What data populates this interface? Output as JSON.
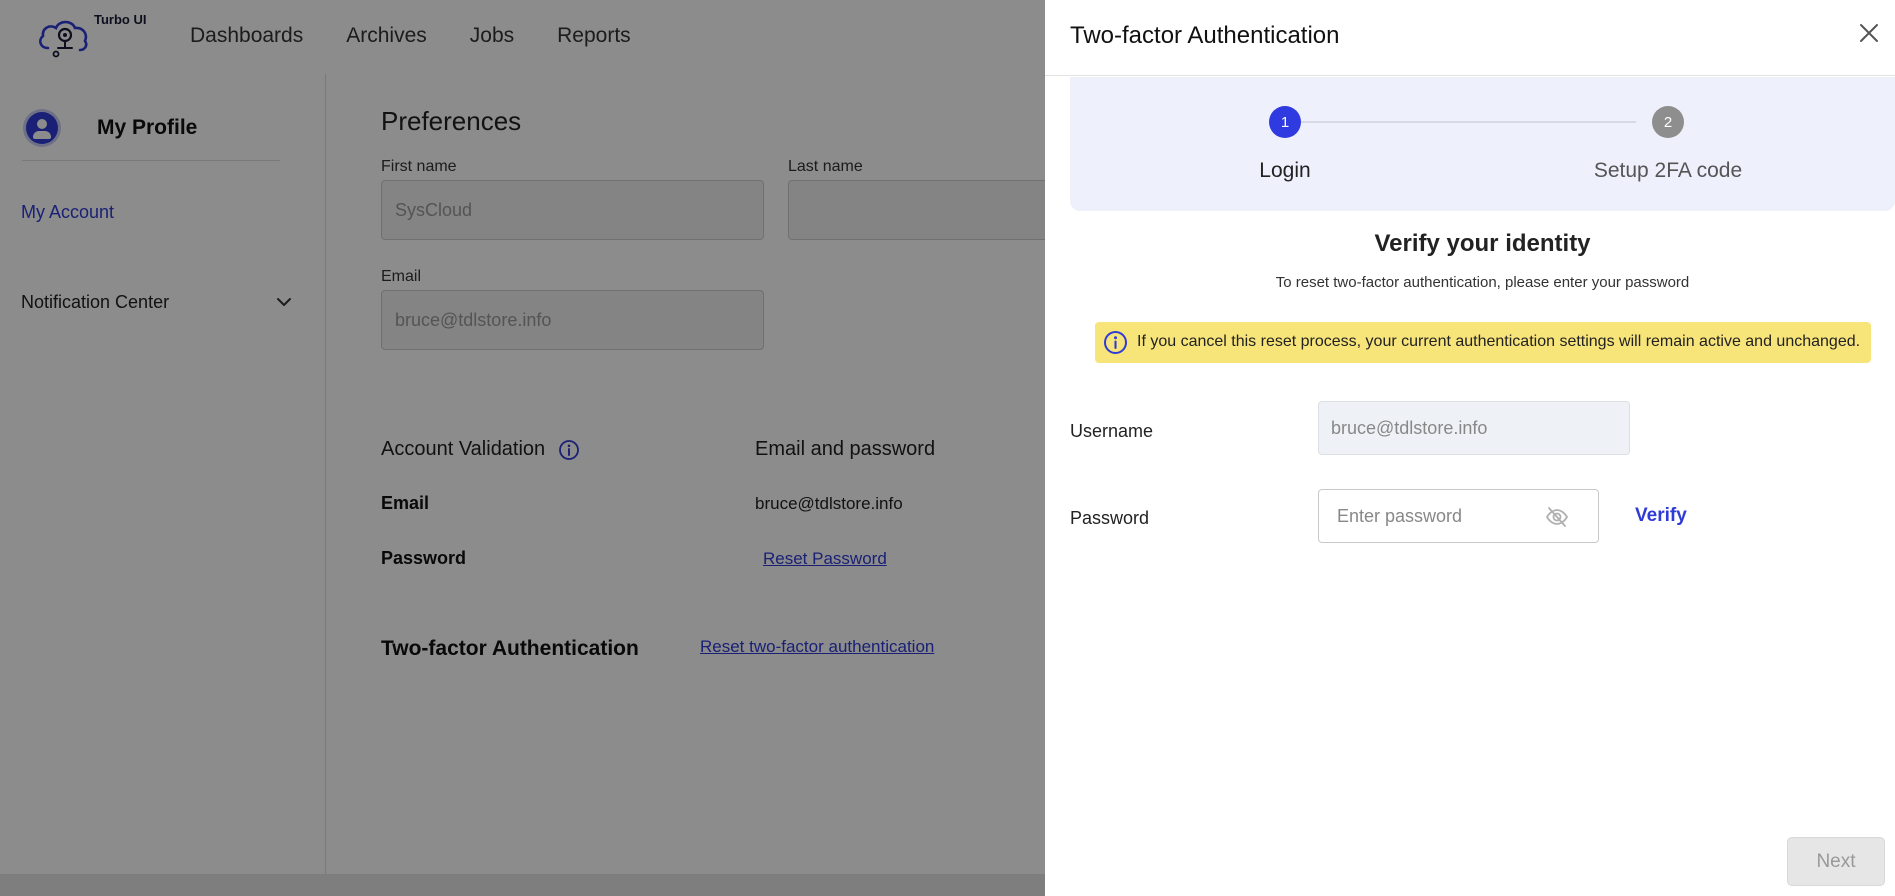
{
  "app": {
    "logo_text": "Turbo UI",
    "nav": [
      "Dashboards",
      "Archives",
      "Jobs",
      "Reports"
    ]
  },
  "sidebar": {
    "profile_title": "My Profile",
    "my_account": "My Account",
    "notification_center": "Notification Center"
  },
  "preferences": {
    "title": "Preferences",
    "first_name_label": "First name",
    "first_name_value": "SysCloud",
    "last_name_label": "Last name",
    "last_name_value": "",
    "email_label": "Email",
    "email_value": "bruce@tdlstore.info"
  },
  "account_validation": {
    "title": "Account Validation",
    "method_header": "Email and password",
    "email_label": "Email",
    "email_value": "bruce@tdlstore.info",
    "password_label": "Password",
    "reset_password_link": "Reset Password",
    "tfa_label": "Two-factor Authentication",
    "reset_tfa_link": "Reset two-factor authentication"
  },
  "drawer": {
    "title": "Two-factor Authentication",
    "steps": [
      {
        "number": "1",
        "label": "Login",
        "active": true
      },
      {
        "number": "2",
        "label": "Setup 2FA code",
        "active": false
      }
    ],
    "verify_title": "Verify your identity",
    "verify_subtitle": "To reset two-factor authentication, please enter your password",
    "alert_text": "If you cancel this reset process, your current authentication settings will remain active and unchanged.",
    "username_label": "Username",
    "username_value": "bruce@tdlstore.info",
    "password_label": "Password",
    "password_placeholder": "Enter password",
    "verify_button": "Verify",
    "next_button": "Next"
  },
  "colors": {
    "accent": "#2f3be0",
    "alert_bg": "#f8e57a",
    "stepper_bg": "#eef0fc"
  }
}
